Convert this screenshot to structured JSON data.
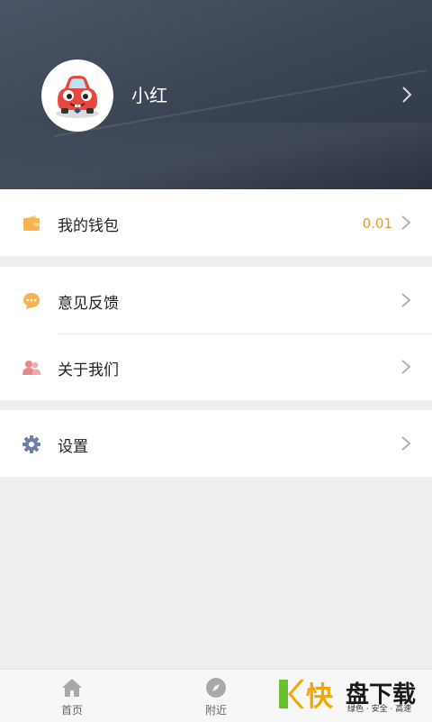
{
  "profile": {
    "name": "小红",
    "avatar_icon": "red-cartoon-car-icon",
    "chevron_icon": "chevron-right-icon"
  },
  "menu": {
    "wallet": {
      "label": "我的钱包",
      "value": "0.01",
      "icon": "wallet-icon",
      "icon_color": "#f5b450"
    },
    "feedback": {
      "label": "意见反馈",
      "icon": "chat-bubble-icon",
      "icon_color": "#f5b450"
    },
    "about": {
      "label": "关于我们",
      "icon": "people-icon",
      "icon_color": "#e88a8a"
    },
    "settings": {
      "label": "设置",
      "icon": "gear-icon",
      "icon_color": "#6f7fa5"
    }
  },
  "tabbar": {
    "home": {
      "label": "首页",
      "icon": "home-icon"
    },
    "nearby": {
      "label": "附近",
      "icon": "compass-icon"
    }
  },
  "watermark": {
    "brand": "快",
    "brand2": "盘下载",
    "slogan": "绿色 · 安全 · 高速",
    "colors": {
      "k_green": "#6cbf2e",
      "k_orange": "#f2a800"
    }
  },
  "colors": {
    "header_bg": "#3c4656",
    "accent_value": "#e89a2c",
    "page_bg": "#efefef"
  }
}
